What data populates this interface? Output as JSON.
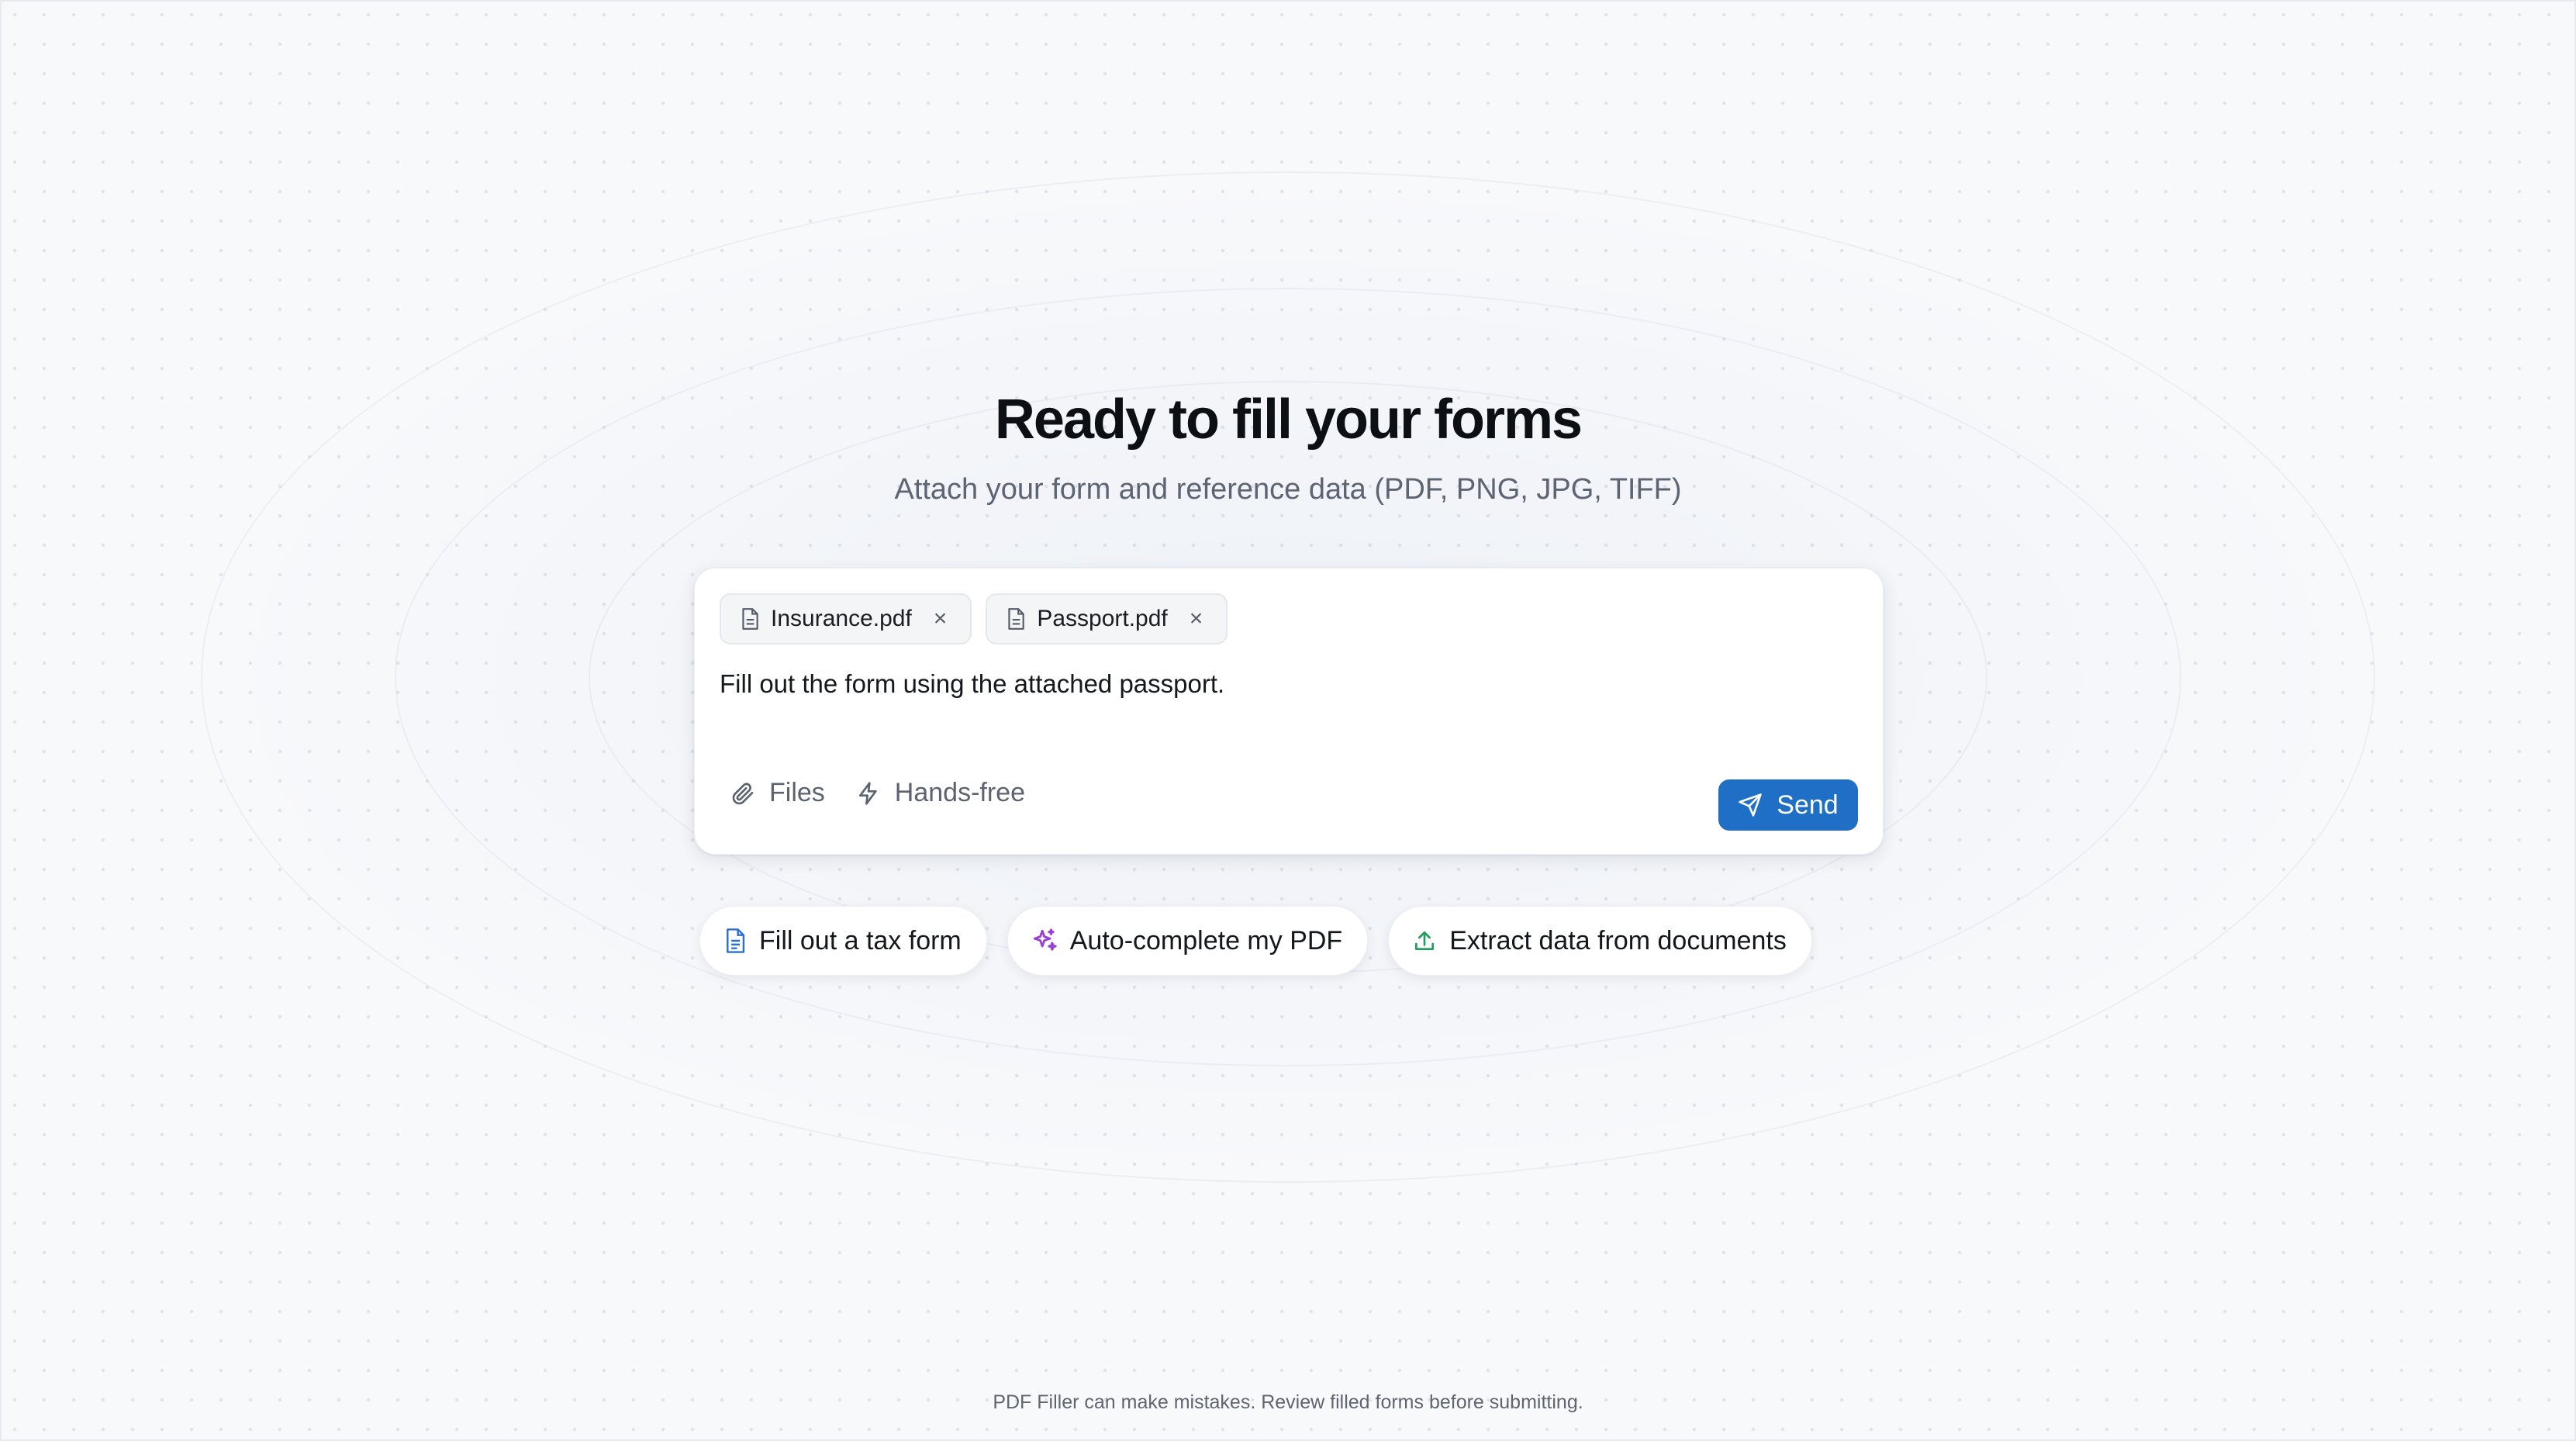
{
  "header": {
    "title": "Ready to fill your forms",
    "subtitle": "Attach your form and reference data (PDF, PNG, JPG, TIFF)"
  },
  "composer": {
    "attachments": [
      {
        "name": "Insurance.pdf",
        "icon": "file-icon",
        "remove": "×"
      },
      {
        "name": "Passport.pdf",
        "icon": "file-icon",
        "remove": "×"
      }
    ],
    "prompt": "Fill out the form using the attached passport.",
    "files_label": "Files",
    "files_icon": "paperclip-icon",
    "handsfree_label": "Hands-free",
    "handsfree_icon": "lightning-icon",
    "send_label": "Send",
    "send_icon": "send-icon",
    "send_color": "#1f6fc7"
  },
  "suggestions": [
    {
      "label": "Fill out a tax form",
      "icon": "document-icon",
      "color": "#2b6fd6"
    },
    {
      "label": "Auto-complete my PDF",
      "icon": "sparkles-icon",
      "color": "#9b3fd6"
    },
    {
      "label": "Extract data from documents",
      "icon": "upload-icon",
      "color": "#1f9e5b"
    }
  ],
  "footer": {
    "disclaimer": "PDF Filler can make mistakes. Review filled forms before submitting."
  }
}
